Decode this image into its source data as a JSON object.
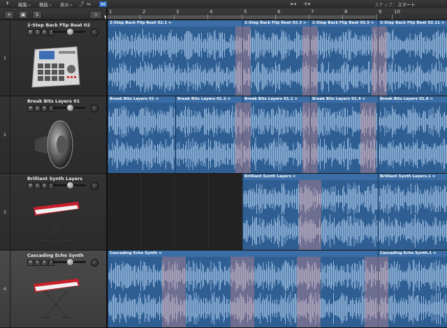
{
  "menubar": {
    "left_glyph": "⇞",
    "menus": [
      {
        "label": "編集"
      },
      {
        "label": "機能"
      },
      {
        "label": "表示"
      }
    ],
    "snap_label": "スナップ：",
    "snap_value": "スマート"
  },
  "header_buttons": {
    "add": "+",
    "folder": "▣",
    "s": "S",
    "collapse": "⊃"
  },
  "ruler": {
    "bars": [
      "1",
      "2",
      "3",
      "4",
      "5",
      "6",
      "7",
      "8",
      "9",
      "10"
    ]
  },
  "controls": {
    "mute": "M",
    "solo": "S",
    "record": "R",
    "input": "I"
  },
  "tracks": [
    {
      "number": "1",
      "name": "2-Step Back Flip Beat 02",
      "regions": [
        {
          "title": "2-Step Back Flip Beat 02.1 ∞"
        },
        {
          "title": "2-Step Back Flip Beat 02.3 ∞"
        },
        {
          "title": "2-Step Back Flip Beat 02.5 ∞"
        },
        {
          "title": "2-Step Back Flip Beat 02.11 ∞"
        }
      ]
    },
    {
      "number": "2",
      "name": "Break Bits Layers 01",
      "regions": [
        {
          "title": "Break Bits Layers 01 ∞"
        },
        {
          "title": "Break Bits Layers 01.2 ∞"
        },
        {
          "title": "Break Bits Layers 01.1 ∞"
        },
        {
          "title": "Break Bits Layers 01.4 ∞"
        },
        {
          "title": "Break Bits Layers 01.8 ∞"
        }
      ]
    },
    {
      "number": "3",
      "name": "Brilliant Synth Layers",
      "regions": [
        {
          "title": "Brilliant Synth Layers ∞"
        },
        {
          "title": "Brilliant Synth Layers.1 ∞"
        }
      ]
    },
    {
      "number": "4",
      "name": "Cascading Echo Synth",
      "regions": [
        {
          "title": "Cascading Echo Synth ∞"
        },
        {
          "title": "Cascading Echo Synth.1 ∞"
        }
      ]
    }
  ],
  "colors": {
    "region": "#2f5e92",
    "region_header": "#3b6ea6",
    "waveform": "#a9c8ea",
    "fade": "#e68c8c"
  },
  "icons": [
    "drum-machine-icon",
    "speaker-icon",
    "synth-keyboard-icon",
    "synth-keyboard-icon"
  ]
}
